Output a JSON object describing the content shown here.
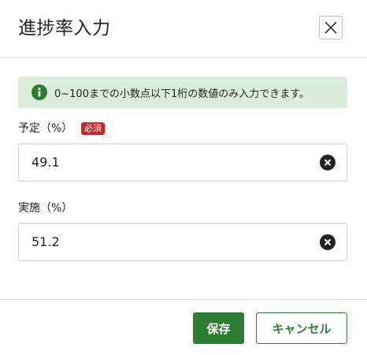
{
  "dialog": {
    "title": "進捗率入力",
    "close_icon": "close-icon"
  },
  "info": {
    "icon": "info-icon",
    "message": "0~100までの小数点以下1桁の数値のみ入力できます。"
  },
  "fields": {
    "planned": {
      "label": "予定（%）",
      "required_badge": "必須",
      "value": "49.1",
      "clear_icon": "clear-icon"
    },
    "actual": {
      "label": "実施（%）",
      "value": "51.2",
      "clear_icon": "clear-icon"
    }
  },
  "footer": {
    "save_label": "保存",
    "cancel_label": "キャンセル"
  },
  "colors": {
    "primary": "#2f7d32",
    "banner_bg": "#dbeedb",
    "required": "#c62828"
  }
}
